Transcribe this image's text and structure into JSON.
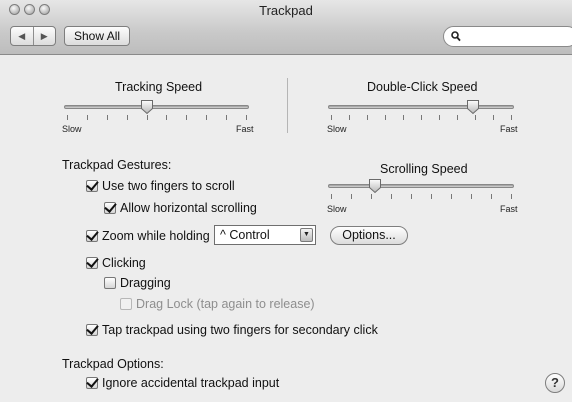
{
  "window": {
    "title": "Trackpad"
  },
  "toolbar": {
    "back_glyph": "◀",
    "forward_glyph": "▶",
    "show_all_label": "Show All",
    "search_placeholder": "",
    "search_value": ""
  },
  "sliders": {
    "tracking": {
      "label": "Tracking Speed",
      "min_label": "Slow",
      "max_label": "Fast",
      "ticks": 10,
      "value_fraction": 0.45
    },
    "double_click": {
      "label": "Double-Click Speed",
      "min_label": "Slow",
      "max_label": "Fast",
      "ticks": 11,
      "value_fraction": 0.78
    },
    "scrolling": {
      "label": "Scrolling Speed",
      "min_label": "Slow",
      "max_label": "Fast",
      "ticks": 10,
      "value_fraction": 0.25
    }
  },
  "gestures": {
    "heading": "Trackpad Gestures:",
    "two_fingers_scroll": {
      "label": "Use two fingers to scroll",
      "checked": true
    },
    "horizontal_scrolling": {
      "label": "Allow horizontal scrolling",
      "checked": true
    },
    "zoom_while_holding": {
      "label": "Zoom while holding",
      "checked": true
    },
    "zoom_modifier": "^ Control",
    "options_label": "Options...",
    "clicking": {
      "label": "Clicking",
      "checked": true
    },
    "dragging": {
      "label": "Dragging",
      "checked": false
    },
    "drag_lock": {
      "label": "Drag Lock (tap again to release)",
      "checked": false,
      "enabled": false
    },
    "secondary_click": {
      "label": "Tap trackpad using two fingers for secondary click",
      "checked": true
    }
  },
  "trackpad_options": {
    "heading": "Trackpad Options:",
    "ignore_accidental": {
      "label": "Ignore accidental trackpad input",
      "checked": true
    }
  },
  "help": {
    "glyph": "?"
  },
  "icons": [
    "close-icon",
    "minimize-icon",
    "zoom-icon",
    "back-icon",
    "forward-icon",
    "search-icon",
    "help-icon"
  ]
}
